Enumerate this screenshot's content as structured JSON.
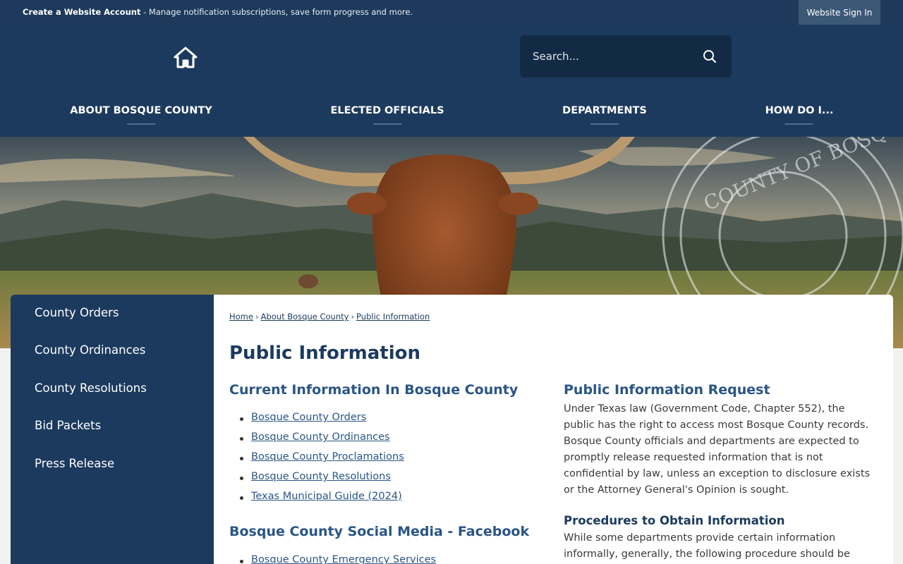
{
  "topbar": {
    "account_link": "Create a Website Account",
    "account_desc": "- Manage notification subscriptions, save form progress and more.",
    "signin_label": "Website Sign In"
  },
  "header": {
    "home_icon": "home-icon",
    "search_placeholder": "Search...",
    "search_icon": "search-icon",
    "nav": [
      {
        "label": "ABOUT BOSQUE COUNTY"
      },
      {
        "label": "ELECTED OFFICIALS"
      },
      {
        "label": "DEPARTMENTS"
      },
      {
        "label": "HOW DO I..."
      }
    ]
  },
  "hero": {
    "seal_text": "COUNTY OF BOSQUE"
  },
  "sidebar": {
    "items": [
      {
        "label": "County Orders"
      },
      {
        "label": "County Ordinances"
      },
      {
        "label": "County Resolutions"
      },
      {
        "label": "Bid Packets"
      },
      {
        "label": "Press Release"
      }
    ]
  },
  "breadcrumb": [
    "Home",
    "About Bosque County",
    "Public Information"
  ],
  "page_title": "Public Information",
  "left_column": {
    "section1_title": "Current Information In Bosque County",
    "links": [
      "Bosque County Orders",
      "Bosque County Ordinances",
      "Bosque County Proclamations",
      "Bosque County Resolutions",
      "Texas Municipal Guide (2024)"
    ],
    "section2_title": "Bosque County Social Media - Facebook",
    "section2_links": [
      "Bosque County Emergency Services"
    ]
  },
  "right_column": {
    "section1_title": "Public Information Request",
    "section1_text": "Under Texas law (Government Code, Chapter 552), the public has the right to access most Bosque County records. Bosque County officials and departments are expected to promptly release requested information that is not confidential by law, unless an exception to disclosure exists or the Attorney General's Opinion is sought.",
    "section2_title": "Procedures to Obtain Information",
    "section2_text": "While some departments provide certain information informally, generally, the following procedure should be"
  },
  "colors": {
    "header_bg": "#1c3a5e",
    "accent_link": "#2a5585"
  }
}
